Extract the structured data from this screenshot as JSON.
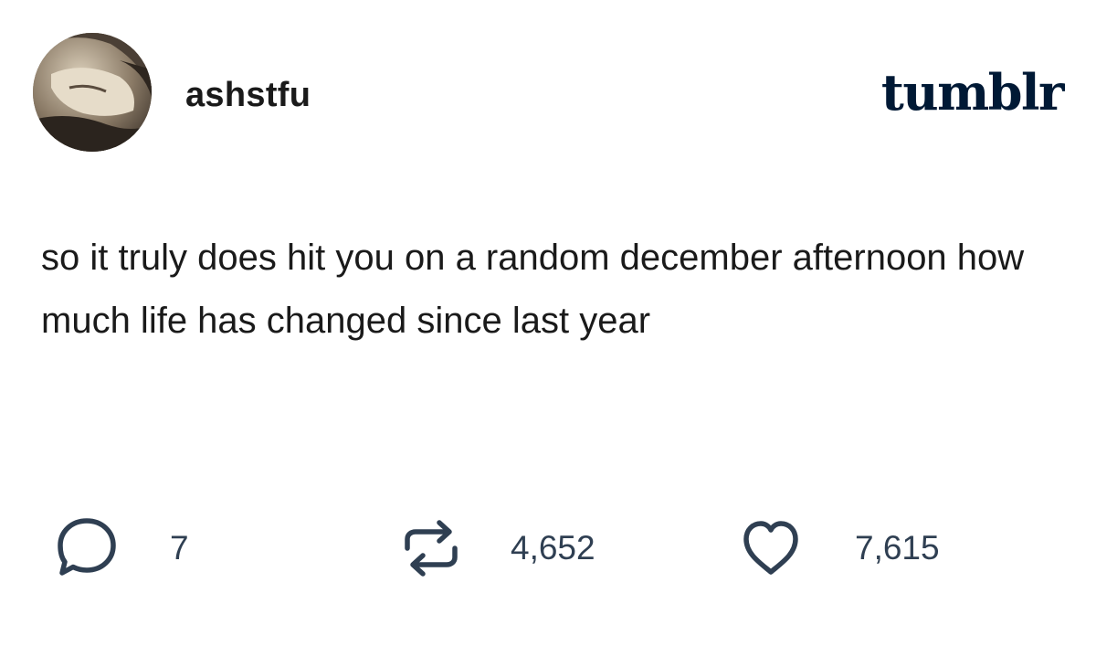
{
  "post": {
    "username": "ashstfu",
    "brand": "tumblr",
    "text": "so it truly does hit you on a random december afternoon how much life has changed since last year"
  },
  "stats": {
    "comments": "7",
    "reblogs": "4,652",
    "likes": "7,615"
  },
  "icons": {
    "comment": "speech-bubble-icon",
    "reblog": "reblog-arrows-icon",
    "like": "heart-icon"
  },
  "colors": {
    "brand": "#001935",
    "icon": "#2f3f52",
    "text": "#1a1a1a"
  }
}
